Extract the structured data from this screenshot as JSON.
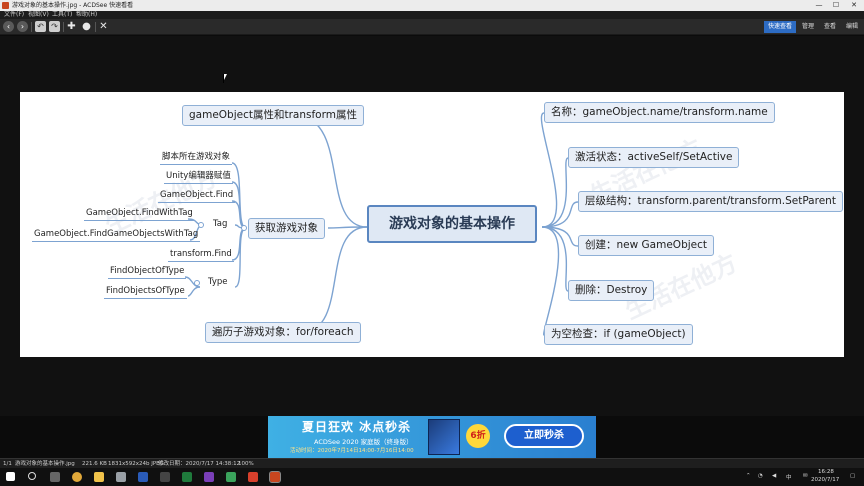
{
  "window": {
    "title": "游戏对象的基本操作.jpg - ACDSee 快速看看",
    "controls": {
      "minimize": "—",
      "maximize": "☐",
      "close": "✕"
    }
  },
  "menu": [
    "文件(F)",
    "视图(V)",
    "工具(T)",
    "帮助(H)"
  ],
  "modes": [
    "快速查看",
    "管理",
    "查看",
    "编辑"
  ],
  "colors": {
    "accent": "#2d6cc4",
    "node_border": "#8fb0d6",
    "root_border": "#5a86c0",
    "link": "#7da3d1"
  },
  "mindmap": {
    "root": "游戏对象的基本操作",
    "left": {
      "props": "gameObject属性和transform属性",
      "acquire": "获取游戏对象",
      "iterate": "遍历子游戏对象：for/foreach",
      "acquire_children": [
        "脚本所在游戏对象",
        "Unity编辑器赋值",
        "GameObject.Find",
        "transform.Find"
      ],
      "tag": {
        "label": "Tag",
        "children": [
          "GameObject.FindWithTag",
          "GameObject.FindGameObjectsWithTag"
        ]
      },
      "type": {
        "label": "Type",
        "children": [
          "FindObjectOfType",
          "FindObjectsOfType"
        ]
      }
    },
    "right": [
      "名称：gameObject.name/transform.name",
      "激活状态：activeSelf/SetActive",
      "层级结构：transform.parent/transform.SetParent",
      "创建：new GameObject",
      "删除：Destroy",
      "为空检查：if (gameObject)"
    ],
    "watermark": "生活在他方"
  },
  "ad": {
    "headline": "夏日狂欢 冰点秒杀",
    "product": "ACDSee 2020 家庭版（终身版）",
    "period": "活动时间：2020年7月14日14:00-7月16日14:00",
    "discount": "6折",
    "cta": "立即秒杀"
  },
  "status": {
    "index": "1/1",
    "filename": "游戏对象的基本操作.jpg",
    "size": "221.6 KB",
    "dims": "1831x592x24b JPEG",
    "modified": "修改日期：2020/7/17 14:38:12",
    "zoom": "100%"
  },
  "taskbar": {
    "time": "16:28",
    "date": "2020/7/17",
    "ime": "中"
  }
}
